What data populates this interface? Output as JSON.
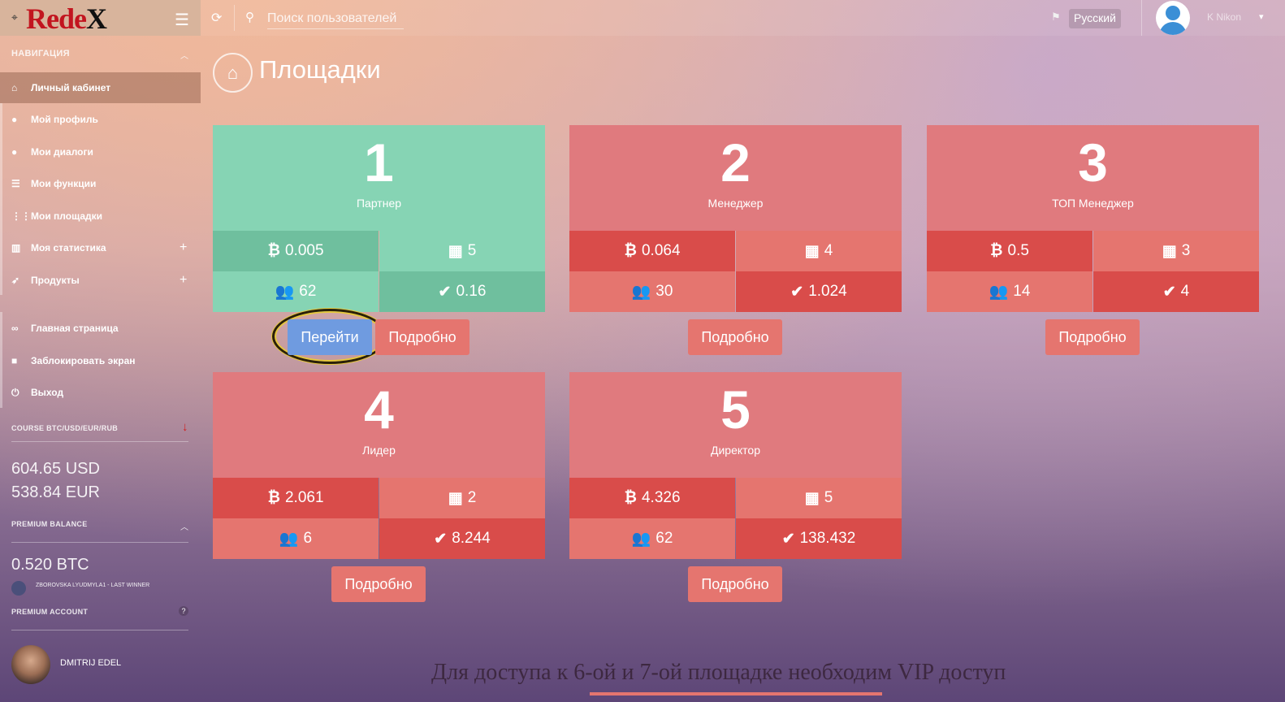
{
  "header": {
    "brand": "RedeX",
    "search_placeholder": "Поиск пользователей",
    "language": "Русский",
    "user_name": "K     Nikon"
  },
  "sidebar": {
    "nav_title": "НАВИГАЦИЯ",
    "items": [
      {
        "label": "Личный кабинет",
        "icon": "home-icon"
      },
      {
        "label": "Мой профиль",
        "icon": "user-icon"
      },
      {
        "label": "Мои диалоги",
        "icon": "chat-icon"
      },
      {
        "label": "Мои функции",
        "icon": "list-icon"
      },
      {
        "label": "Мои площадки",
        "icon": "grid-icon"
      },
      {
        "label": "Моя статистика",
        "icon": "chart-icon"
      },
      {
        "label": "Продукты",
        "icon": "rocket-icon"
      },
      {
        "label": "Главная страница",
        "icon": "link-icon"
      },
      {
        "label": "Заблокировать экран",
        "icon": "lock-icon"
      },
      {
        "label": "Выход",
        "icon": "power-icon"
      }
    ],
    "course_title": "COURSE BTC/USD/EUR/RUB",
    "course_usd": "604.65 USD",
    "course_eur": "538.84 EUR",
    "premium_balance_title": "PREMIUM BALANCE",
    "premium_balance": "0.520 BTC",
    "last_winner": "ZBOROVSKA LYUDMYLA1 - LAST WINNER",
    "premium_account_title": "PREMIUM ACCOUNT",
    "profile_name": "DMITRIJ EDEL"
  },
  "main": {
    "title": "Площадки",
    "cards": [
      {
        "num": "1",
        "role": "Партнер",
        "btc": "0.005",
        "table": "5",
        "users": "62",
        "check": "0.16",
        "theme": "#86d4b4"
      },
      {
        "num": "2",
        "role": "Менеджер",
        "btc": "0.064",
        "table": "4",
        "users": "30",
        "check": "1.024",
        "theme": "#e07a7e"
      },
      {
        "num": "3",
        "role": "ТОП Менеджер",
        "btc": "0.5",
        "table": "3",
        "users": "14",
        "check": "4",
        "theme": "#e07a7e"
      },
      {
        "num": "4",
        "role": "Лидер",
        "btc": "2.061",
        "table": "2",
        "users": "6",
        "check": "8.244",
        "theme": "#e07a7e"
      },
      {
        "num": "5",
        "role": "Директор",
        "btc": "4.326",
        "table": "5",
        "users": "62",
        "check": "138.432",
        "theme": "#e07a7e"
      }
    ],
    "go_label": "Перейти",
    "more_label": "Подробно",
    "footer_note": "Для доступа к 6-ой и 7-ой площадке необходим VIP доступ"
  }
}
